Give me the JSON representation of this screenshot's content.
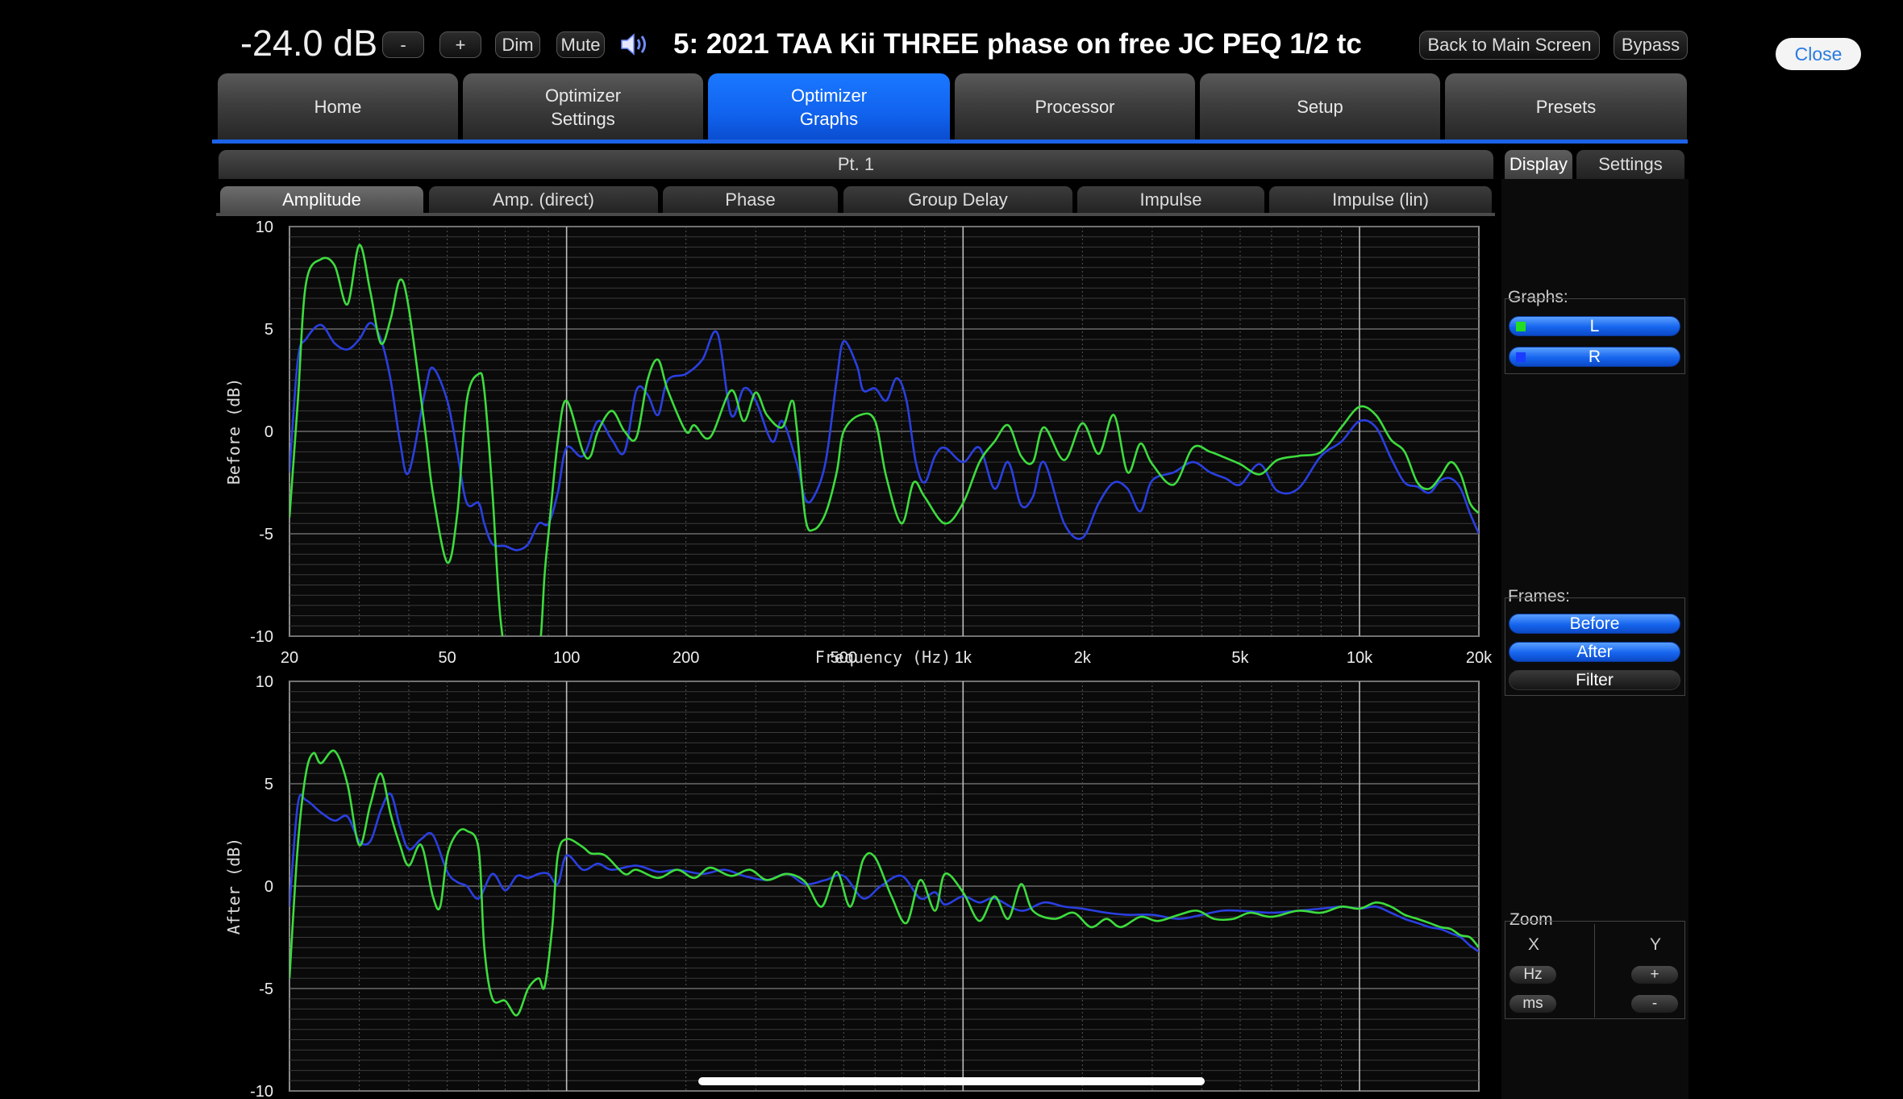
{
  "topbar": {
    "volume": "-24.0 dB",
    "minus_label": "-",
    "plus_label": "+",
    "dim_label": "Dim",
    "mute_label": "Mute",
    "speaker_icon": "speaker-volume-icon",
    "preset_title": "5: 2021 TAA Kii THREE phase on free JC PEQ 1/2 tc",
    "back_label": "Back to Main Screen",
    "bypass_label": "Bypass",
    "close_label": "Close"
  },
  "tabs": [
    {
      "label": "Home",
      "active": false
    },
    {
      "label": "Optimizer\nSettings",
      "active": false
    },
    {
      "label": "Optimizer\nGraphs",
      "active": true
    },
    {
      "label": "Processor",
      "active": false
    },
    {
      "label": "Setup",
      "active": false
    },
    {
      "label": "Presets",
      "active": false
    }
  ],
  "point_label": "Pt. 1",
  "right_tabs": {
    "display": "Display",
    "settings": "Settings",
    "active": "Display"
  },
  "graph_tabs": [
    "Amplitude",
    "Amp. (direct)",
    "Phase",
    "Group Delay",
    "Impulse",
    "Impulse (lin)"
  ],
  "active_graph_tab": "Amplitude",
  "side_panel": {
    "graphs_label": "Graphs:",
    "graphs": [
      {
        "label": "L",
        "color": "#22dd22",
        "on": true
      },
      {
        "label": "R",
        "color": "#1a3cff",
        "on": true
      }
    ],
    "frames_label": "Frames:",
    "frames": [
      {
        "label": "Before",
        "on": true
      },
      {
        "label": "After",
        "on": true
      },
      {
        "label": "Filter",
        "on": false
      }
    ],
    "zoom_label": "Zoom",
    "zoom_x_label": "X",
    "zoom_y_label": "Y",
    "zoom_hz_label": "Hz",
    "zoom_ms_label": "ms",
    "zoom_plus_label": "+",
    "zoom_minus_label": "-"
  },
  "colors": {
    "accent": "#1565f0",
    "series_L": "#3ddc3d",
    "series_R": "#2a3fe0",
    "grid": "#555555"
  },
  "chart_data": [
    {
      "type": "line",
      "ylabel": "Before (dB)",
      "xlabel": "Frequency (Hz)",
      "x_scale": "log",
      "xlim": [
        20,
        20000
      ],
      "ylim": [
        -10,
        10
      ],
      "x_ticks": [
        "20",
        "50",
        "100",
        "200",
        "500",
        "1k",
        "2k",
        "5k",
        "10k",
        "20k"
      ],
      "y_ticks": [
        "10",
        "5",
        "0",
        "-5",
        "-10"
      ],
      "grid": true,
      "series": [
        {
          "name": "L",
          "color": "#3ddc3d",
          "x": [
            20,
            21,
            22,
            24,
            26,
            28,
            30,
            32,
            34,
            36,
            38,
            40,
            44,
            46,
            50,
            53,
            56,
            60,
            62,
            65,
            68,
            72,
            78,
            85,
            88,
            90,
            95,
            100,
            110,
            115,
            120,
            130,
            140,
            150,
            160,
            170,
            180,
            200,
            210,
            230,
            260,
            280,
            300,
            320,
            350,
            370,
            380,
            400,
            420,
            450,
            480,
            500,
            550,
            600,
            640,
            700,
            750,
            800,
            900,
            1000,
            1100,
            1200,
            1300,
            1400,
            1500,
            1600,
            1800,
            2000,
            2200,
            2400,
            2600,
            2800,
            3000,
            3400,
            3800,
            4200,
            4600,
            5000,
            5600,
            6200,
            7000,
            8000,
            9000,
            10000,
            11000,
            12000,
            13000,
            14000,
            15000,
            16000,
            17000,
            18000,
            19000,
            20000
          ],
          "y": [
            -4.2,
            1.5,
            7.2,
            8.4,
            8.1,
            6.2,
            9.1,
            6.8,
            4.3,
            5.5,
            7.4,
            6.0,
            0,
            -3,
            -6.4,
            -4,
            1.5,
            2.8,
            2,
            -3,
            -9,
            -12,
            -13,
            -11,
            -7,
            -5,
            -0.5,
            1.5,
            -1,
            -1.2,
            0,
            1,
            0,
            -0.3,
            2.5,
            3.5,
            2,
            0,
            0.3,
            -0.3,
            2.0,
            0.5,
            1.9,
            0.8,
            0.2,
            1.5,
            0.3,
            -4.2,
            -4.8,
            -4,
            -2,
            0,
            0.8,
            0.5,
            -2.2,
            -4.5,
            -2.5,
            -3.2,
            -4.5,
            -3.5,
            -1.5,
            -0.5,
            0.3,
            -1.2,
            -1.5,
            0.2,
            -1.4,
            0.4,
            -1.1,
            0.8,
            -2.0,
            -0.6,
            -1.6,
            -2.6,
            -0.8,
            -1.0,
            -1.3,
            -1.6,
            -2.1,
            -1.4,
            -1.2,
            -1.0,
            0.2,
            1.2,
            0.8,
            -0.4,
            -1.0,
            -2.5,
            -2.8,
            -2.2,
            -1.5,
            -2.1,
            -3.5,
            -4.0
          ]
        },
        {
          "name": "R",
          "color": "#2a3fe0",
          "x": [
            20,
            21,
            22,
            24,
            26,
            28,
            30,
            32,
            34,
            36,
            38,
            40,
            44,
            46,
            50,
            53,
            56,
            60,
            62,
            65,
            70,
            75,
            80,
            85,
            90,
            95,
            100,
            110,
            120,
            130,
            140,
            150,
            160,
            170,
            180,
            200,
            220,
            240,
            260,
            280,
            300,
            330,
            350,
            380,
            400,
            420,
            450,
            480,
            500,
            540,
            560,
            600,
            640,
            680,
            720,
            760,
            800,
            850,
            900,
            1000,
            1100,
            1200,
            1300,
            1400,
            1500,
            1600,
            1800,
            2000,
            2200,
            2400,
            2600,
            2800,
            3000,
            3400,
            3800,
            4200,
            4600,
            5000,
            5600,
            6200,
            7000,
            8000,
            9000,
            10000,
            11000,
            12000,
            13000,
            14000,
            15000,
            16000,
            17000,
            18000,
            19000,
            20000
          ],
          "y": [
            -2,
            3.5,
            4.5,
            5.2,
            4.3,
            4.0,
            4.5,
            5.3,
            4.5,
            2.5,
            -0.5,
            -2,
            2.0,
            3.1,
            1.5,
            -1,
            -3.5,
            -3.5,
            -4.5,
            -5.5,
            -5.6,
            -5.8,
            -5.5,
            -4.5,
            -4.5,
            -3,
            -0.8,
            -1.2,
            0.5,
            -0.4,
            -1.0,
            2.0,
            1.8,
            0.8,
            2.5,
            2.8,
            3.5,
            4.8,
            0.8,
            2.1,
            1.5,
            -0.5,
            0.5,
            -1.5,
            -3.3,
            -3.2,
            -1.5,
            2.5,
            4.4,
            3.2,
            2.0,
            2.1,
            1.5,
            2.6,
            1.5,
            -1.5,
            -2.5,
            -1.2,
            -0.8,
            -1.5,
            -0.8,
            -2.8,
            -1.5,
            -3.6,
            -3.2,
            -1.5,
            -4.5,
            -5.2,
            -3.5,
            -2.5,
            -2.8,
            -3.9,
            -2.4,
            -2.0,
            -1.5,
            -2.0,
            -2.3,
            -2.6,
            -1.6,
            -2.9,
            -2.8,
            -1.2,
            -0.5,
            0.5,
            0.2,
            -1.3,
            -2.5,
            -2.7,
            -3.0,
            -2.4,
            -2.3,
            -2.8,
            -4.0,
            -5.0
          ]
        }
      ]
    },
    {
      "type": "line",
      "ylabel": "After (dB)",
      "xlabel": "",
      "x_scale": "log",
      "xlim": [
        20,
        20000
      ],
      "ylim": [
        -10,
        10
      ],
      "y_ticks": [
        "10",
        "5",
        "0",
        "-5",
        "-10"
      ],
      "grid": true,
      "series": [
        {
          "name": "L",
          "color": "#3ddc3d",
          "x": [
            20,
            21,
            22,
            23,
            24,
            26,
            28,
            30,
            32,
            34,
            36,
            38,
            40,
            43,
            46,
            48,
            50,
            53,
            56,
            60,
            62,
            65,
            70,
            75,
            80,
            85,
            88,
            92,
            95,
            100,
            110,
            115,
            125,
            140,
            150,
            170,
            190,
            210,
            230,
            260,
            290,
            320,
            360,
            400,
            440,
            480,
            520,
            560,
            600,
            660,
            720,
            780,
            850,
            900,
            1000,
            1100,
            1200,
            1300,
            1400,
            1500,
            1700,
            1900,
            2100,
            2300,
            2500,
            2800,
            3100,
            3500,
            3900,
            4300,
            4800,
            5300,
            6000,
            7000,
            8000,
            9000,
            10000,
            11000,
            12000,
            13000,
            14000,
            15000,
            16000,
            17000,
            18000,
            19000,
            20000
          ],
          "y": [
            -4.5,
            2.0,
            5.5,
            6.5,
            6.0,
            6.6,
            5.0,
            2.0,
            4.0,
            5.5,
            3.5,
            2.0,
            1.0,
            2.0,
            -0.5,
            -1.0,
            1.5,
            2.6,
            2.7,
            1.8,
            -3.0,
            -5.5,
            -5.6,
            -6.3,
            -5.0,
            -4.5,
            -4.9,
            -2.0,
            1.5,
            2.3,
            1.9,
            1.6,
            1.5,
            0.6,
            0.8,
            0.4,
            0.8,
            0.4,
            0.9,
            0.5,
            0.8,
            0.3,
            0.6,
            0.2,
            -1.0,
            0.7,
            -1.0,
            1.3,
            1.4,
            -0.5,
            -1.8,
            0.3,
            -1.2,
            0.6,
            -0.3,
            -1.7,
            -0.5,
            -1.6,
            0.1,
            -1.2,
            -1.6,
            -1.3,
            -2.0,
            -1.6,
            -2.0,
            -1.5,
            -1.7,
            -1.4,
            -1.2,
            -1.6,
            -1.6,
            -1.3,
            -1.5,
            -1.2,
            -1.3,
            -1.0,
            -1.1,
            -0.8,
            -1.0,
            -1.4,
            -1.6,
            -1.8,
            -2.0,
            -2.1,
            -2.4,
            -2.5,
            -3.0
          ]
        },
        {
          "name": "R",
          "color": "#2a3fe0",
          "x": [
            20,
            21,
            22,
            24,
            26,
            28,
            30,
            32,
            34,
            36,
            38,
            40,
            43,
            46,
            50,
            53,
            56,
            60,
            65,
            70,
            75,
            80,
            85,
            90,
            95,
            100,
            110,
            120,
            130,
            150,
            170,
            190,
            220,
            250,
            280,
            320,
            360,
            400,
            450,
            500,
            560,
            620,
            700,
            780,
            850,
            900,
            1000,
            1100,
            1200,
            1400,
            1600,
            1800,
            2000,
            2300,
            2600,
            3000,
            3500,
            4000,
            4500,
            5000,
            6000,
            7000,
            8000,
            9000,
            10000,
            11000,
            12000,
            13000,
            14000,
            15000,
            16000,
            17000,
            18000,
            19000,
            20000
          ],
          "y": [
            -1,
            4.0,
            4.2,
            3.6,
            3.2,
            3.4,
            2.2,
            2.2,
            3.7,
            4.5,
            2.9,
            1.8,
            2.3,
            2.5,
            0.7,
            0.2,
            0.0,
            -0.6,
            0.6,
            -0.2,
            0.5,
            0.4,
            0.6,
            0.6,
            0.1,
            1.5,
            0.8,
            1.1,
            0.8,
            1.0,
            0.7,
            0.8,
            0.6,
            0.8,
            0.5,
            0.3,
            0.6,
            0.1,
            0.3,
            0.5,
            -0.6,
            0.0,
            0.5,
            -0.6,
            -0.3,
            -0.9,
            -0.5,
            -0.8,
            -0.6,
            -1.2,
            -0.8,
            -1.0,
            -1.1,
            -1.3,
            -1.4,
            -1.4,
            -1.6,
            -1.4,
            -1.2,
            -1.2,
            -1.3,
            -1.2,
            -1.1,
            -1.0,
            -1.1,
            -1.0,
            -1.3,
            -1.6,
            -1.8,
            -2.0,
            -2.1,
            -2.3,
            -2.5,
            -2.9,
            -3.2
          ]
        }
      ]
    }
  ]
}
